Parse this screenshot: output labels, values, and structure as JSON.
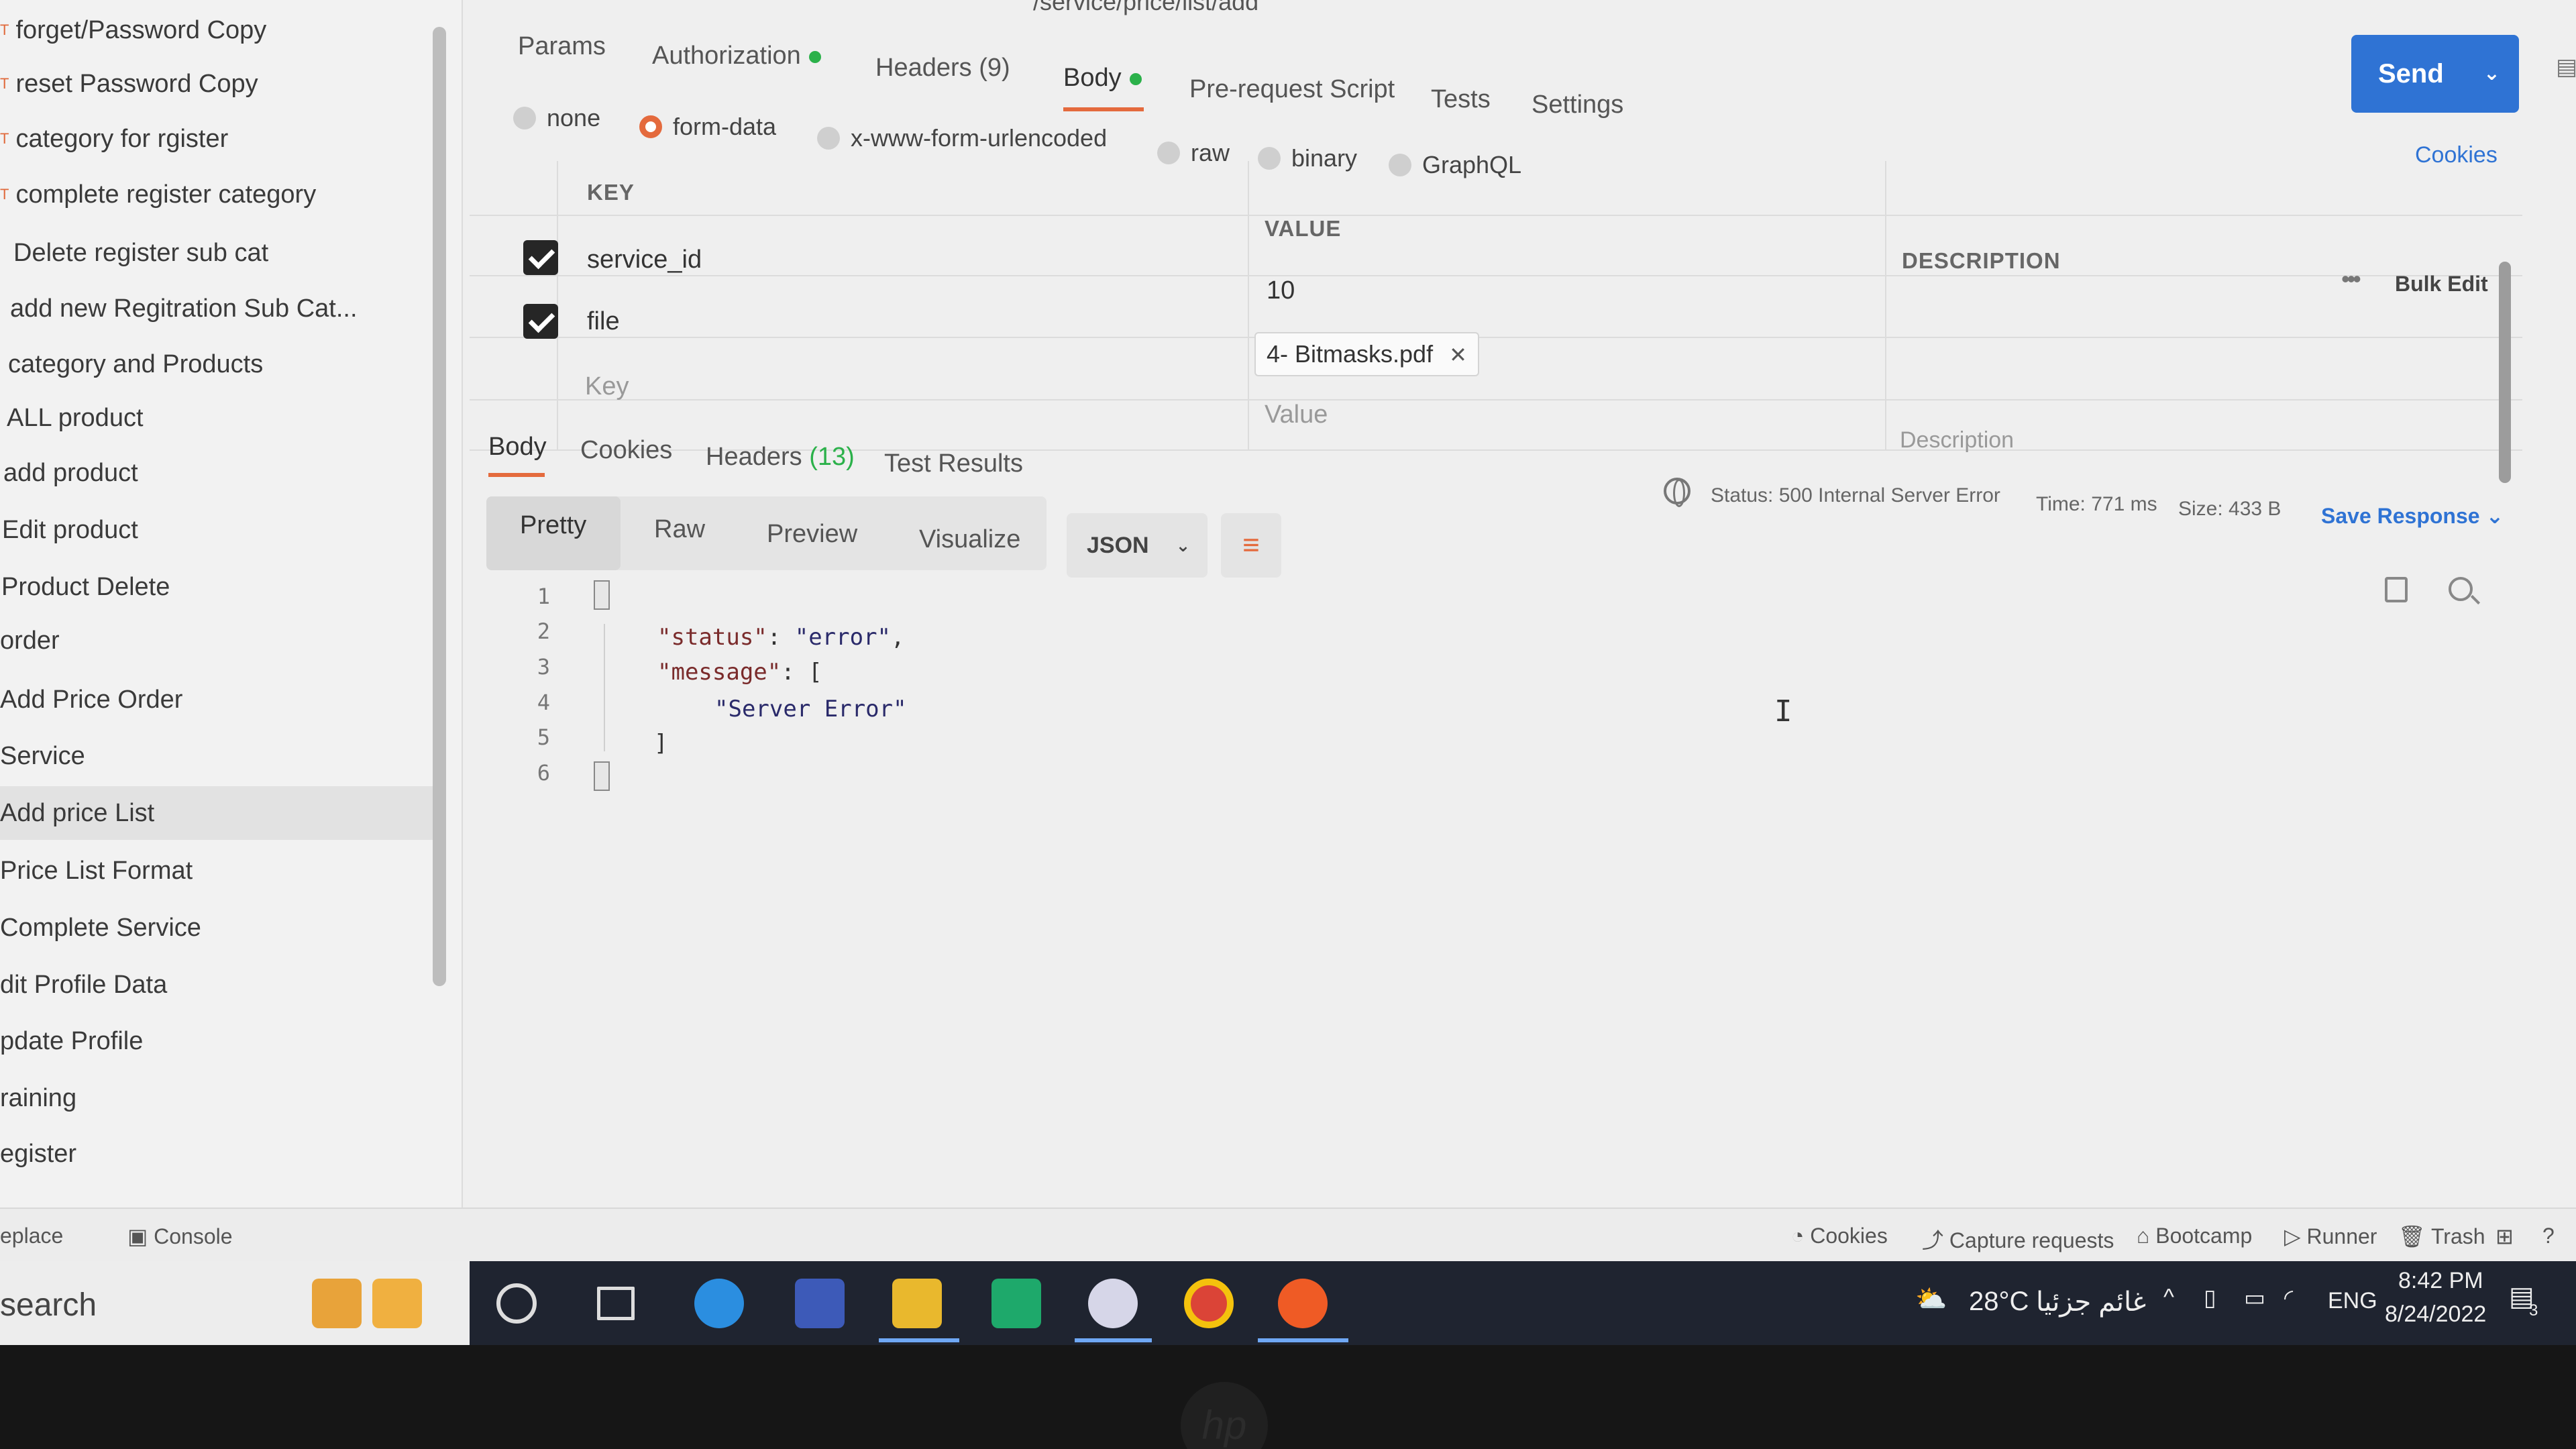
{
  "url": "/service/price/list/add",
  "sidebar": {
    "items": [
      {
        "label": "forget/Password Copy"
      },
      {
        "label": "reset Password Copy"
      },
      {
        "label": "category for rgister"
      },
      {
        "label": "complete register category"
      },
      {
        "label": "Delete register sub cat"
      },
      {
        "label": "add new Regitration Sub Cat..."
      },
      {
        "label": "category and Products"
      },
      {
        "label": "ALL product"
      },
      {
        "label": "add product"
      },
      {
        "label": "Edit product"
      },
      {
        "label": "Product Delete"
      },
      {
        "label": "order"
      },
      {
        "label": "Add Price Order"
      },
      {
        "label": "Service"
      },
      {
        "label": "Add price List"
      },
      {
        "label": "Price List Format"
      },
      {
        "label": "Complete Service"
      },
      {
        "label": "dit Profile Data"
      },
      {
        "label": "pdate Profile"
      },
      {
        "label": "raining"
      },
      {
        "label": "egister"
      }
    ]
  },
  "send": {
    "label": "Send"
  },
  "request_tabs": [
    {
      "label": "Params"
    },
    {
      "label": "Authorization"
    },
    {
      "label": "Headers (9)"
    },
    {
      "label": "Body"
    },
    {
      "label": "Pre-request Script"
    },
    {
      "label": "Tests"
    },
    {
      "label": "Settings"
    }
  ],
  "body_types": [
    {
      "label": "none"
    },
    {
      "label": "form-data"
    },
    {
      "label": "x-www-form-urlencoded"
    },
    {
      "label": "raw"
    },
    {
      "label": "binary"
    },
    {
      "label": "GraphQL"
    }
  ],
  "cookies_link": "Cookies",
  "params": {
    "headers": {
      "key": "KEY",
      "value": "VALUE",
      "description": "DESCRIPTION"
    },
    "bulk_edit": "Bulk Edit",
    "rows": [
      {
        "key": "service_id",
        "value": "10"
      },
      {
        "key": "file",
        "value": "4- Bitmasks.pdf"
      }
    ],
    "placeholders": {
      "key": "Key",
      "value": "Value",
      "description": "Description"
    }
  },
  "response_tabs": [
    {
      "label": "Body"
    },
    {
      "label": "Cookies"
    },
    {
      "label": "Headers",
      "count": "(13)"
    },
    {
      "label": "Test Results"
    }
  ],
  "response_status": {
    "status": "Status: 500 Internal Server Error",
    "time": "Time: 771 ms",
    "size": "Size: 433 B",
    "save": "Save Response"
  },
  "view_modes": [
    {
      "label": "Pretty"
    },
    {
      "label": "Raw"
    },
    {
      "label": "Preview"
    },
    {
      "label": "Visualize"
    }
  ],
  "format": "JSON",
  "code_lines": [
    {
      "n": "1",
      "text": ""
    },
    {
      "n": "2",
      "key": "\"status\"",
      "rest": ": ",
      "str": "\"error\"",
      "tail": ","
    },
    {
      "n": "3",
      "key": "\"message\"",
      "rest": ": [",
      "str": "",
      "tail": ""
    },
    {
      "n": "4",
      "key": "",
      "rest": "",
      "str": "\"Server Error\"",
      "tail": ""
    },
    {
      "n": "5",
      "key": "",
      "rest": "]",
      "str": "",
      "tail": ""
    },
    {
      "n": "6",
      "text": ""
    }
  ],
  "app_status": {
    "left1": "eplace",
    "console": "Console",
    "cookies": "Cookies",
    "capture": "Capture requests",
    "bootcamp": "Bootcamp",
    "runner": "Runner",
    "trash": "Trash"
  },
  "taskbar": {
    "search": "search",
    "weather": "28°C",
    "weather_desc": "غائم جزئيا",
    "lang": "ENG",
    "time": "8:42 PM",
    "date": "8/24/2022",
    "notif_count": "3"
  },
  "colors": {
    "accent": "#e46a3d",
    "send": "#2f73d4",
    "green": "#2bb14a"
  }
}
